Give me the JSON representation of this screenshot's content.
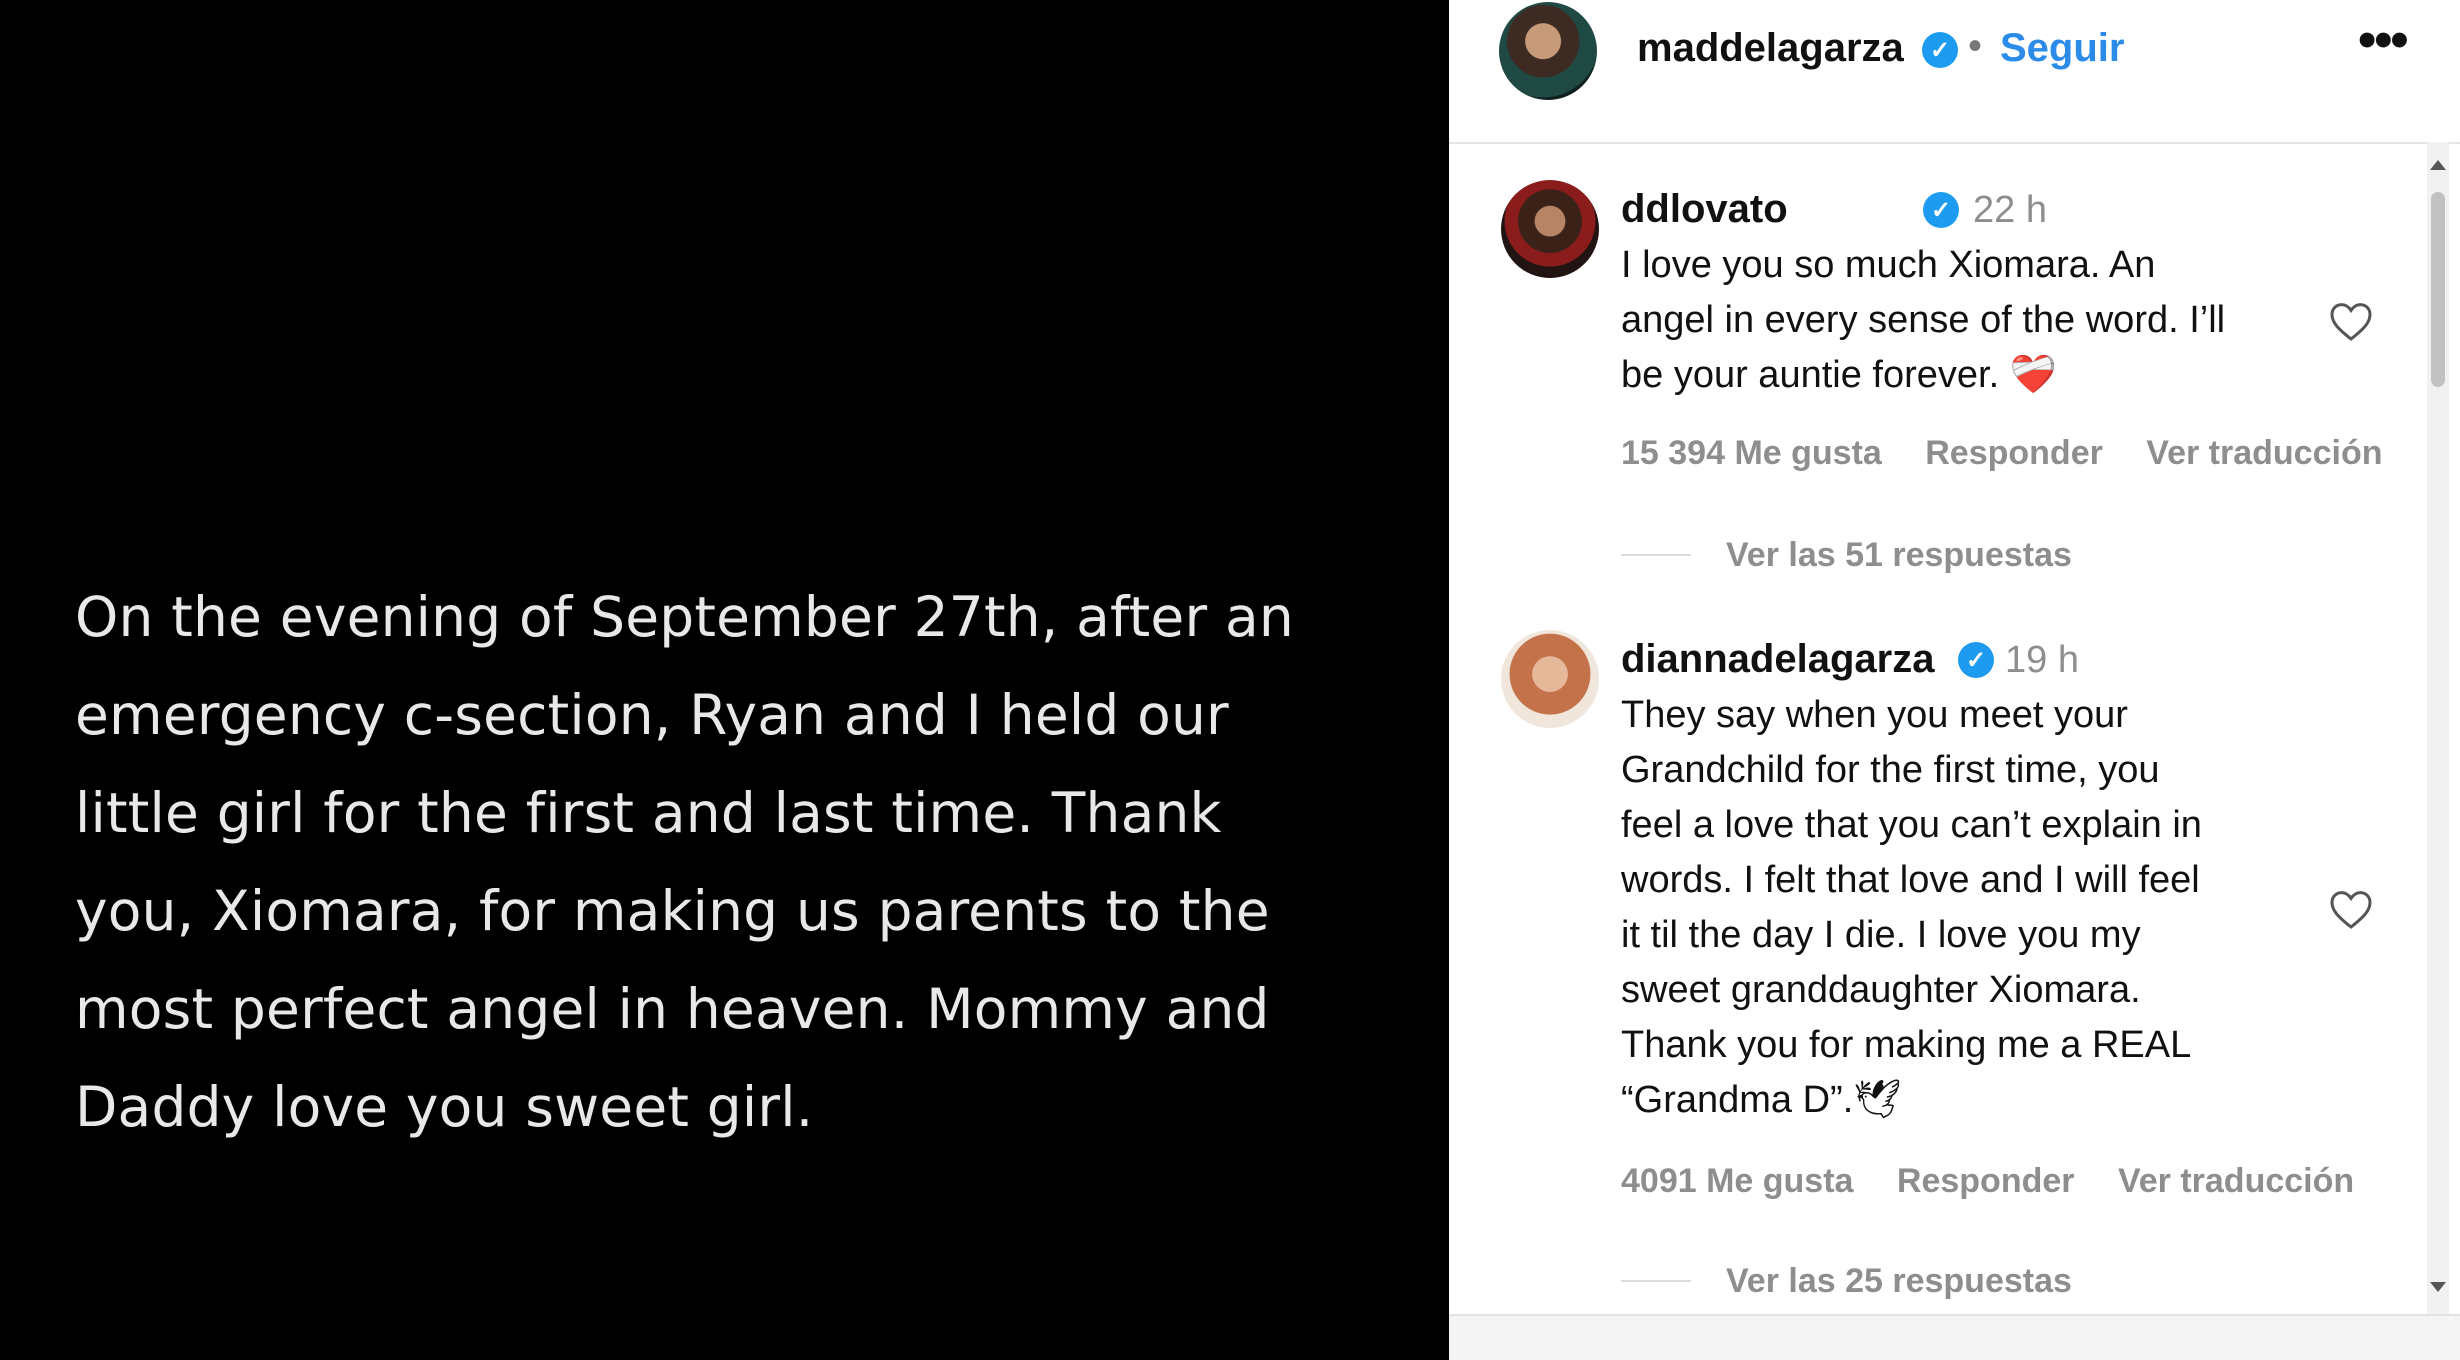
{
  "post": {
    "text": "On the evening of September 27th, after an\nemergency c-section, Ryan and I held our\nlittle girl for the first and last time. Thank\nyou, Xiomara, for making us parents to the\nmost perfect angel in heaven. Mommy and\nDaddy love you sweet girl."
  },
  "header": {
    "username": "maddelagarza",
    "separator": "•",
    "follow_label": "Seguir",
    "more_label": "•••"
  },
  "comments": [
    {
      "username": "ddlovato",
      "time": "22 h",
      "text": "I love you so much Xiomara. An\nangel in every sense of the word. I’ll\nbe your auntie forever. ❤️‍🩹",
      "likes": "15 394 Me gusta",
      "reply_label": "Responder",
      "translate_label": "Ver traducción",
      "replies_label": "Ver las 51 respuestas"
    },
    {
      "username": "diannadelagarza",
      "time": "19 h",
      "text": "They say when you meet your\nGrandchild for the first time, you\nfeel a love that you can’t explain in\nwords. I felt that love and I will feel\nit til the day I die. I love you my\nsweet granddaughter Xiomara.\nThank you for making me a REAL\n“Grandma D”.🕊",
      "likes": "4091 Me gusta",
      "reply_label": "Responder",
      "translate_label": "Ver traducción",
      "replies_label": "Ver las 25 respuestas"
    }
  ],
  "colors": {
    "accent": "#2a8ce8",
    "verified": "#1d9bf0",
    "muted": "#8e8e8e"
  }
}
